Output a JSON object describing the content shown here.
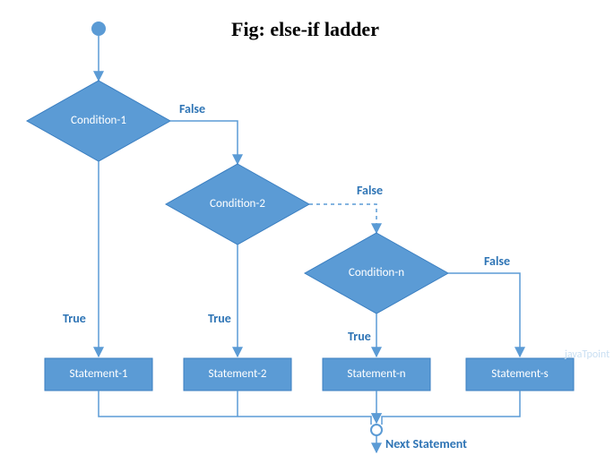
{
  "title": "Fig: else-if ladder",
  "conditions": {
    "c1": "Condition-1",
    "c2": "Condition-2",
    "cn": "Condition-n"
  },
  "statements": {
    "s1": "Statement-1",
    "s2": "Statement-2",
    "sn": "Statement-n",
    "ss": "Statement-s"
  },
  "labels": {
    "true": "True",
    "false": "False",
    "next": "Next Statement"
  },
  "watermark": "javaTpoint",
  "chart_data": {
    "type": "flowchart",
    "title": "Fig: else-if ladder",
    "nodes": [
      {
        "id": "start",
        "kind": "start"
      },
      {
        "id": "c1",
        "kind": "decision",
        "label": "Condition-1"
      },
      {
        "id": "c2",
        "kind": "decision",
        "label": "Condition-2"
      },
      {
        "id": "cn",
        "kind": "decision",
        "label": "Condition-n"
      },
      {
        "id": "s1",
        "kind": "process",
        "label": "Statement-1"
      },
      {
        "id": "s2",
        "kind": "process",
        "label": "Statement-2"
      },
      {
        "id": "sn",
        "kind": "process",
        "label": "Statement-n"
      },
      {
        "id": "ss",
        "kind": "process",
        "label": "Statement-s"
      },
      {
        "id": "next",
        "kind": "connector",
        "label": "Next Statement"
      }
    ],
    "edges": [
      {
        "from": "start",
        "to": "c1"
      },
      {
        "from": "c1",
        "to": "s1",
        "label": "True"
      },
      {
        "from": "c1",
        "to": "c2",
        "label": "False"
      },
      {
        "from": "c2",
        "to": "s2",
        "label": "True"
      },
      {
        "from": "c2",
        "to": "cn",
        "label": "False",
        "style": "dashed"
      },
      {
        "from": "cn",
        "to": "sn",
        "label": "True"
      },
      {
        "from": "cn",
        "to": "ss",
        "label": "False"
      },
      {
        "from": "s1",
        "to": "next"
      },
      {
        "from": "s2",
        "to": "next"
      },
      {
        "from": "sn",
        "to": "next"
      },
      {
        "from": "ss",
        "to": "next"
      }
    ]
  }
}
